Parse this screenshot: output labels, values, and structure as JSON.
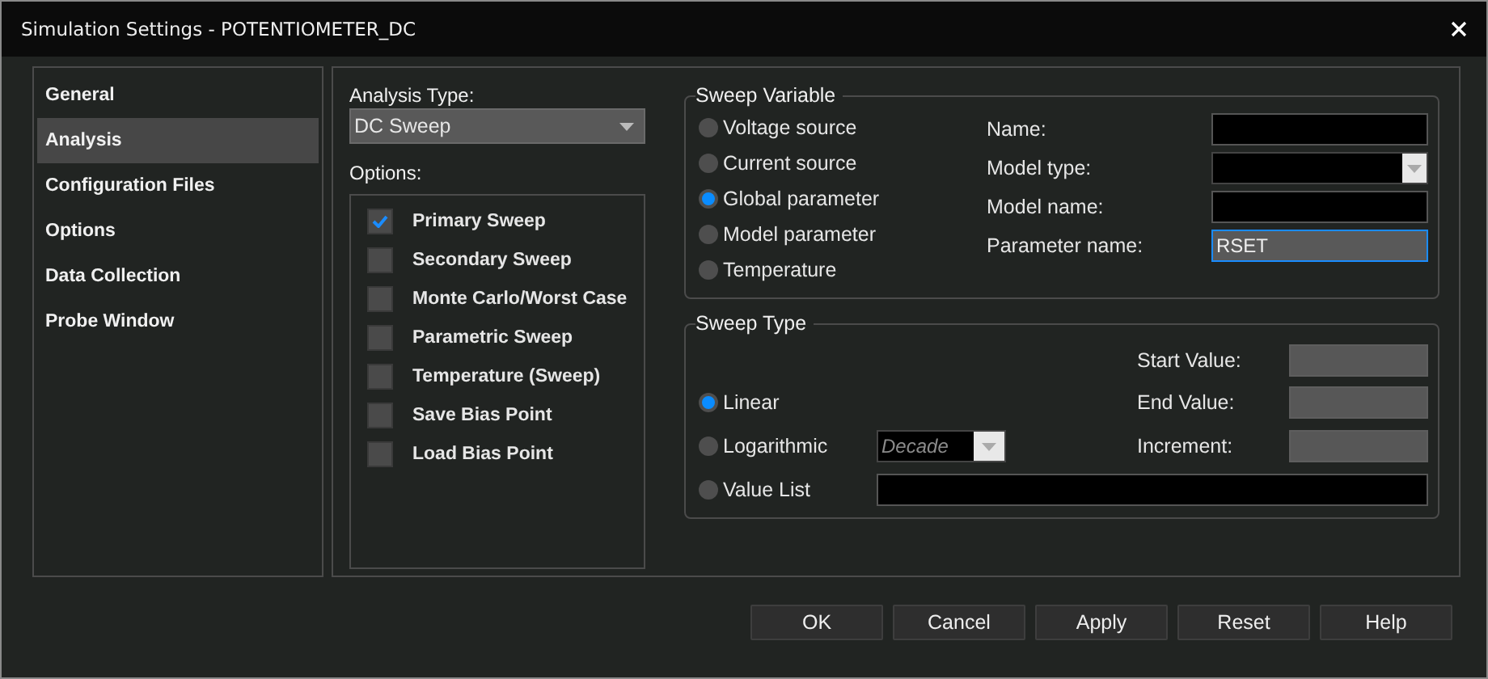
{
  "window": {
    "title": "Simulation Settings - POTENTIOMETER_DC"
  },
  "sidebar": {
    "items": [
      {
        "label": "General",
        "selected": false
      },
      {
        "label": "Analysis",
        "selected": true
      },
      {
        "label": "Configuration Files",
        "selected": false
      },
      {
        "label": "Options",
        "selected": false
      },
      {
        "label": "Data Collection",
        "selected": false
      },
      {
        "label": "Probe Window",
        "selected": false
      }
    ]
  },
  "analysis_type": {
    "label": "Analysis Type:",
    "value": "DC Sweep"
  },
  "options": {
    "label": "Options:",
    "items": [
      {
        "label": "Primary Sweep",
        "checked": true
      },
      {
        "label": "Secondary Sweep",
        "checked": false
      },
      {
        "label": "Monte Carlo/Worst Case",
        "checked": false
      },
      {
        "label": "Parametric Sweep",
        "checked": false
      },
      {
        "label": "Temperature (Sweep)",
        "checked": false
      },
      {
        "label": "Save Bias Point",
        "checked": false
      },
      {
        "label": "Load Bias Point",
        "checked": false
      }
    ]
  },
  "sweep_variable": {
    "title": "Sweep Variable",
    "options": [
      {
        "label": "Voltage source",
        "selected": false
      },
      {
        "label": "Current source",
        "selected": false
      },
      {
        "label": "Global parameter",
        "selected": true
      },
      {
        "label": "Model parameter",
        "selected": false
      },
      {
        "label": "Temperature",
        "selected": false
      }
    ],
    "fields": [
      {
        "kind": "text",
        "label": "Name:",
        "focused": false
      },
      {
        "kind": "dropdown",
        "label": "Model type:",
        "focused": false
      },
      {
        "kind": "text",
        "label": "Model name:",
        "focused": false
      },
      {
        "kind": "text",
        "label": "Parameter name:",
        "value": "RSET",
        "focused": true
      }
    ]
  },
  "sweep_type": {
    "title": "Sweep Type",
    "options": [
      {
        "label": "Linear",
        "selected": true
      },
      {
        "label": "Logarithmic",
        "selected": false
      },
      {
        "label": "Value List",
        "selected": false
      }
    ],
    "log_scale": {
      "value": "Decade",
      "disabled": true
    },
    "values": [
      {
        "label": "Start Value:",
        "disabled": true
      },
      {
        "label": "End Value:",
        "disabled": true
      },
      {
        "label": "Increment:",
        "disabled": true
      }
    ]
  },
  "buttons": [
    "OK",
    "Cancel",
    "Apply",
    "Reset",
    "Help"
  ]
}
